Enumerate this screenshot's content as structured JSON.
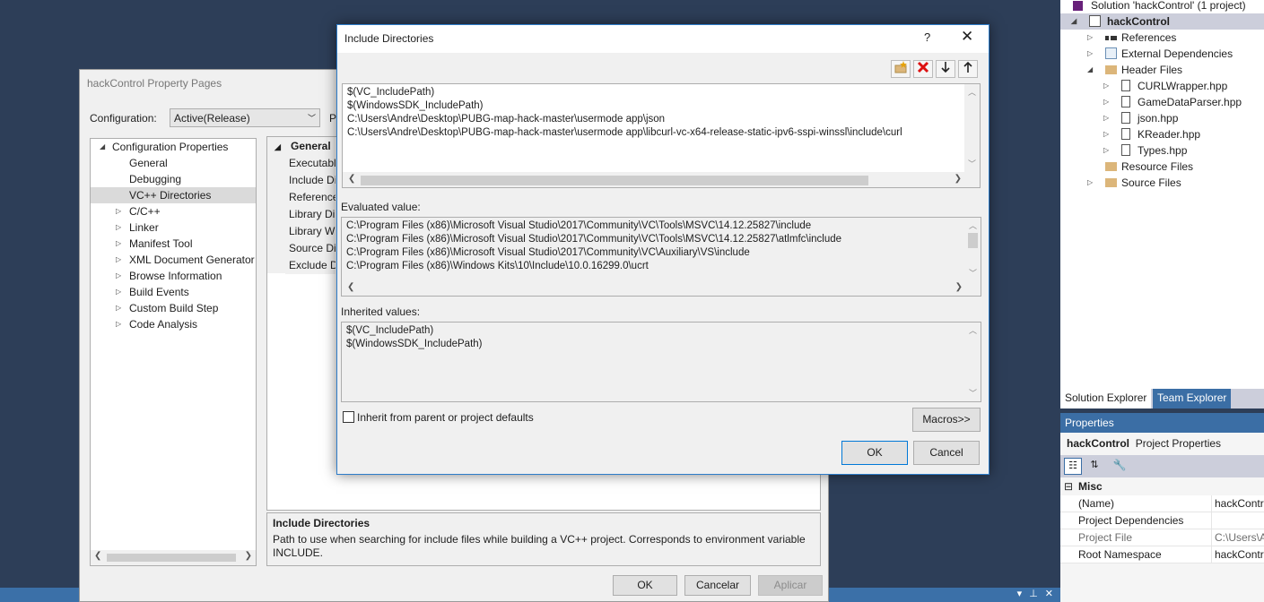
{
  "property_pages": {
    "title": "hackControl Property Pages",
    "configuration_label": "Configuration:",
    "configuration_value": "Active(Release)",
    "platform_label_partial": "Pl",
    "tree": [
      {
        "label": "Configuration Properties",
        "expanded": true,
        "indent": 0
      },
      {
        "label": "General",
        "indent": 1
      },
      {
        "label": "Debugging",
        "indent": 1
      },
      {
        "label": "VC++ Directories",
        "indent": 1,
        "selected": true
      },
      {
        "label": "C/C++",
        "indent": 1,
        "collapsed": true
      },
      {
        "label": "Linker",
        "indent": 1,
        "collapsed": true
      },
      {
        "label": "Manifest Tool",
        "indent": 1,
        "collapsed": true
      },
      {
        "label": "XML Document Generator",
        "indent": 1,
        "collapsed": true
      },
      {
        "label": "Browse Information",
        "indent": 1,
        "collapsed": true
      },
      {
        "label": "Build Events",
        "indent": 1,
        "collapsed": true
      },
      {
        "label": "Custom Build Step",
        "indent": 1,
        "collapsed": true
      },
      {
        "label": "Code Analysis",
        "indent": 1,
        "collapsed": true
      }
    ],
    "grid_category": "General",
    "grid_rows": [
      "Executable",
      "Include Di",
      "Reference",
      "Library Dir",
      "Library Wi",
      "Source Dir",
      "Exclude Di"
    ],
    "description_title": "Include Directories",
    "description_text": "Path to use when searching for include files while building a VC++ project.  Corresponds to environment variable INCLUDE.",
    "ok_label": "OK",
    "cancel_label": "Cancelar",
    "apply_label": "Aplicar"
  },
  "dialog": {
    "title": "Include Directories",
    "help_glyph": "?",
    "close_glyph": "✕",
    "toolbar": {
      "new_line_icon": "new-line-icon",
      "delete_icon": "delete-icon",
      "move_down_icon": "arrow-down-icon",
      "move_up_icon": "arrow-up-icon"
    },
    "edit_lines": [
      "$(VC_IncludePath)",
      "$(WindowsSDK_IncludePath)",
      "C:\\Users\\Andre\\Desktop\\PUBG-map-hack-master\\usermode app\\json",
      "C:\\Users\\Andre\\Desktop\\PUBG-map-hack-master\\usermode app\\libcurl-vc-x64-release-static-ipv6-sspi-winssl\\include\\curl"
    ],
    "evaluated_label": "Evaluated value:",
    "evaluated_lines": [
      "C:\\Program Files (x86)\\Microsoft Visual Studio\\2017\\Community\\VC\\Tools\\MSVC\\14.12.25827\\include",
      "C:\\Program Files (x86)\\Microsoft Visual Studio\\2017\\Community\\VC\\Tools\\MSVC\\14.12.25827\\atlmfc\\include",
      "C:\\Program Files (x86)\\Microsoft Visual Studio\\2017\\Community\\VC\\Auxiliary\\VS\\include",
      "C:\\Program Files (x86)\\Windows Kits\\10\\Include\\10.0.16299.0\\ucrt"
    ],
    "inherited_label": "Inherited values:",
    "inherited_lines": [
      "$(VC_IncludePath)",
      "$(WindowsSDK_IncludePath)"
    ],
    "inherit_checkbox_label": "Inherit from parent or project defaults",
    "inherit_checked": false,
    "macros_label": "Macros>>",
    "ok_label": "OK",
    "cancel_label": "Cancel"
  },
  "solution_explorer": {
    "solution_label": "Solution 'hackControl' (1 project)",
    "project_label": "hackControl",
    "items": [
      {
        "label": "References",
        "indent": 1,
        "collapsed": true,
        "icon": "references-icon"
      },
      {
        "label": "External Dependencies",
        "indent": 1,
        "collapsed": true,
        "icon": "external-deps-icon"
      },
      {
        "label": "Header Files",
        "indent": 1,
        "expanded": true,
        "icon": "folder-icon"
      },
      {
        "label": "CURLWrapper.hpp",
        "indent": 2,
        "collapsed": true,
        "icon": "header-file-icon"
      },
      {
        "label": "GameDataParser.hpp",
        "indent": 2,
        "collapsed": true,
        "icon": "header-file-icon"
      },
      {
        "label": "json.hpp",
        "indent": 2,
        "collapsed": true,
        "icon": "header-file-icon"
      },
      {
        "label": "KReader.hpp",
        "indent": 2,
        "collapsed": true,
        "icon": "header-file-icon"
      },
      {
        "label": "Types.hpp",
        "indent": 2,
        "collapsed": true,
        "icon": "header-file-icon"
      },
      {
        "label": "Resource Files",
        "indent": 1,
        "icon": "folder-icon"
      },
      {
        "label": "Source Files",
        "indent": 1,
        "collapsed": true,
        "icon": "folder-icon"
      }
    ],
    "tabs": [
      "Solution Explorer",
      "Team Explorer"
    ]
  },
  "properties": {
    "header": "Properties",
    "object_name": "hackControl",
    "object_type": "Project Properties",
    "category": "Misc",
    "rows": [
      {
        "key": "(Name)",
        "value": "hackControl"
      },
      {
        "key": "Project Dependencies",
        "value": ""
      },
      {
        "key": "Project File",
        "value": "C:\\Users\\A"
      },
      {
        "key": "Root Namespace",
        "value": "hackContr"
      }
    ]
  },
  "colors": {
    "ide_background": "#2d3e58",
    "accent_blue": "#3b6ea5",
    "dialog_border": "#2d7cc9"
  }
}
